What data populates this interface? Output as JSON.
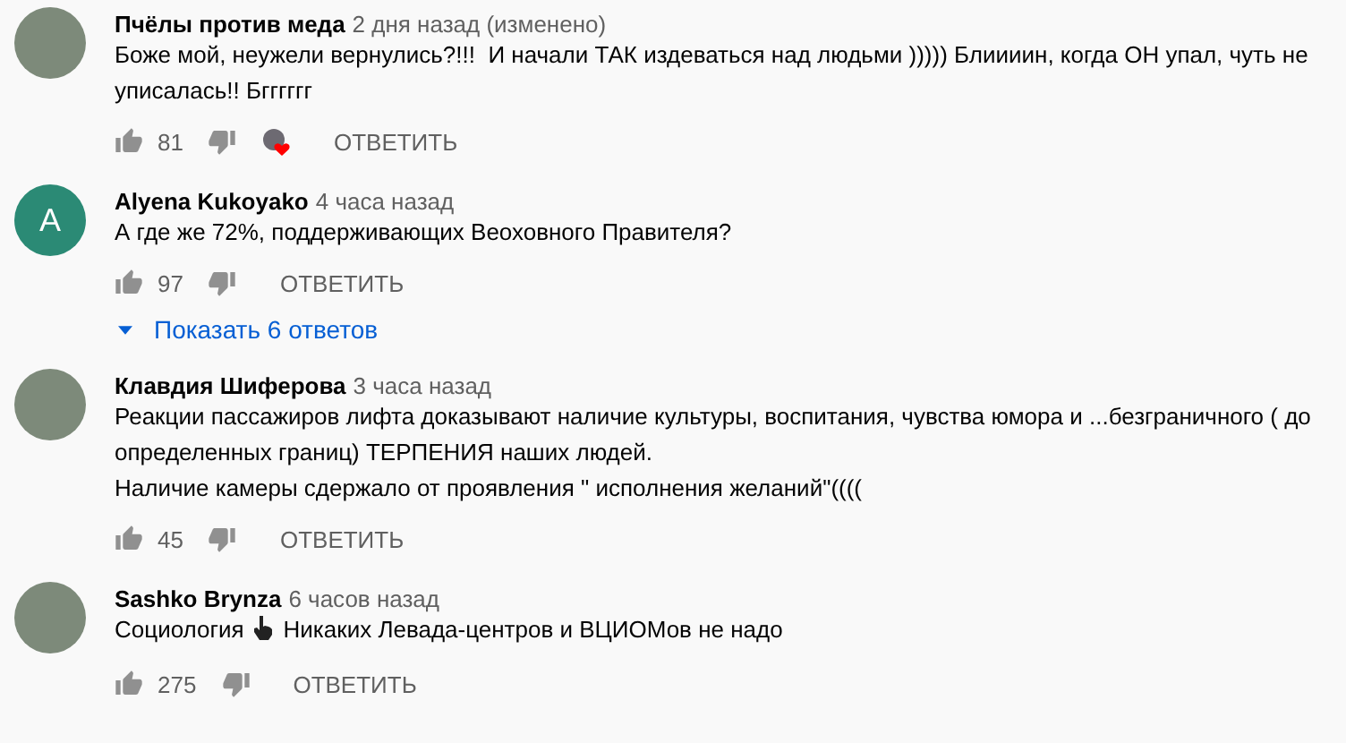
{
  "comments": [
    {
      "author": "Пчёлы против меда",
      "time": "2 дня назад (изменено)",
      "avatar": {
        "kind": "photo"
      },
      "lines": [
        [
          {
            "kind": "text",
            "text": "Боже мой, неужели вернулись?!!!  И начали ТАК издеваться над людьми ))))) Блиииин, когда ОН упал, чуть не уписалась!! Бгггггг"
          }
        ]
      ],
      "likes": "81",
      "hearted": true,
      "reply": "ОТВЕТИТЬ"
    },
    {
      "author": "Alyena Kukoyako",
      "time": "4 часа назад",
      "avatar": {
        "kind": "letter",
        "letter": "A",
        "color": "#2b8a75"
      },
      "lines": [
        [
          {
            "kind": "text",
            "text": "А где же 72%, поддерживающих Веоховного Правителя?"
          }
        ]
      ],
      "likes": "97",
      "hearted": false,
      "reply": "ОТВЕТИТЬ",
      "replies": "Показать 6 ответов"
    },
    {
      "author": "Клавдия Шиферова",
      "time": "3 часа назад",
      "avatar": {
        "kind": "photo"
      },
      "lines": [
        [
          {
            "kind": "text",
            "text": "Реакции пассажиров лифта доказывают наличие культуры, воспитания, чувства юмора и ...безграничного ( до определенных границ) ТЕРПЕНИЯ наших людей."
          }
        ],
        [
          {
            "kind": "text",
            "text": "Наличие камеры сдержало от проявления \" исполнения желаний\"(((("
          }
        ]
      ],
      "likes": "45",
      "hearted": false,
      "reply": "ОТВЕТИТЬ"
    },
    {
      "author": "Sashko Brynza",
      "time": "6 часов назад",
      "avatar": {
        "kind": "photo"
      },
      "lines": [
        [
          {
            "kind": "text",
            "text": "Социология"
          },
          {
            "kind": "hand"
          },
          {
            "kind": "text",
            "text": "Никаких Левада-центров и ВЦИОМов не надо"
          }
        ]
      ],
      "likes": "275",
      "hearted": false,
      "reply": "ОТВЕТИТЬ"
    }
  ]
}
